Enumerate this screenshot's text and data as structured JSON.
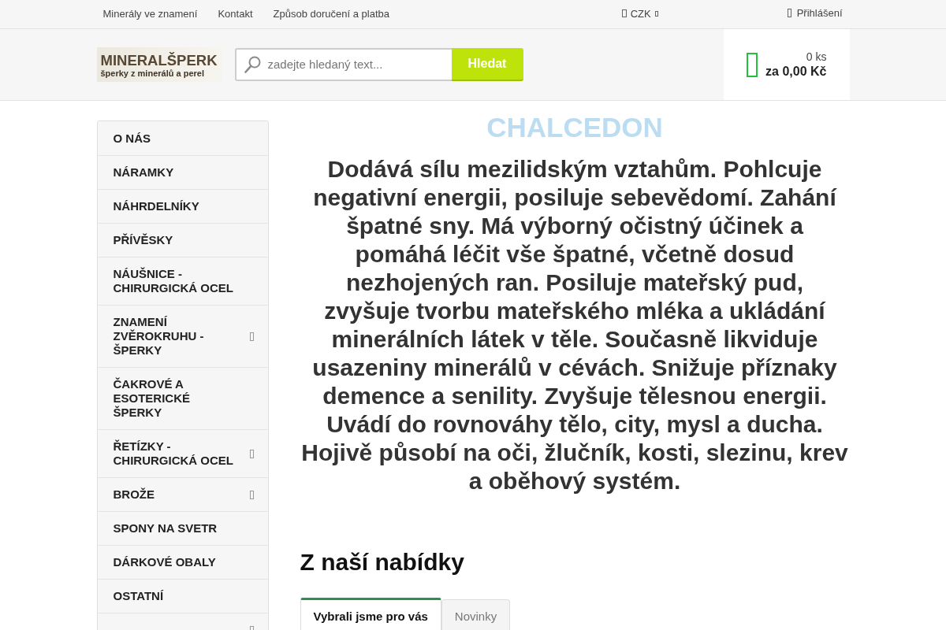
{
  "top_bar": {
    "links": [
      "Minerály ve znamení",
      "Kontakt",
      "Způsob doručení a platba"
    ],
    "currency": {
      "label": "CZK"
    },
    "login": {
      "label": "Přihlášení"
    }
  },
  "header": {
    "logo": {
      "title": "MINERALŠPERK",
      "tagline": "šperky z minerálů a perel"
    },
    "search": {
      "placeholder": "zadejte hledaný text...",
      "button": "Hledat"
    },
    "cart": {
      "count": "0 ks",
      "total": "za 0,00 Kč"
    }
  },
  "sidebar": {
    "items": [
      {
        "label": "O NÁS",
        "has_submenu": false
      },
      {
        "label": "NÁRAMKY",
        "has_submenu": false
      },
      {
        "label": "NÁHRDELNÍKY",
        "has_submenu": false
      },
      {
        "label": "PŘÍVĚSKY",
        "has_submenu": false
      },
      {
        "label": "NÁUŠNICE - CHIRURGICKÁ OCEL",
        "has_submenu": false
      },
      {
        "label": "ZNAMENÍ ZVĚROKRUHU - ŠPERKY",
        "has_submenu": true
      },
      {
        "label": "ČAKROVÉ A ESOTERICKÉ ŠPERKY",
        "has_submenu": false
      },
      {
        "label": "ŘETÍZKY - CHIRURGICKÁ OCEL",
        "has_submenu": true
      },
      {
        "label": "BROŽE",
        "has_submenu": true
      },
      {
        "label": "SPONY NA SVETR",
        "has_submenu": false
      },
      {
        "label": "DÁRKOVÉ OBALY",
        "has_submenu": false
      },
      {
        "label": "OSTATNÍ",
        "has_submenu": false
      },
      {
        "has_submenu": true
      }
    ]
  },
  "article": {
    "title": "CHALCEDON",
    "text": "Dodává sílu mezilidským vztahům. Pohlcuje negativní energii, posiluje sebevědomí. Zahání špatné sny. Má výborný očistný účinek a pomáhá léčit vše špatné, včetně dosud nezhojených ran. Posiluje mateřský pud, zvyšuje tvorbu mateřského mléka a ukládání minerálních látek v těle. Současně likviduje usazeniny minerálů v cévách. Snižuje příznaky demence a senility. Zvyšuje tělesnou energii. Uvádí do rovnováhy tělo, city, mysl a ducha. Hojivě působí na oči, žlučník, kosti, slezinu, krev a oběhový systém."
  },
  "offer": {
    "heading": "Z naší nabídky",
    "tabs": [
      {
        "label": "Vybrali jsme pro vás",
        "selected": true
      },
      {
        "label": "Novinky",
        "selected": false
      }
    ]
  }
}
